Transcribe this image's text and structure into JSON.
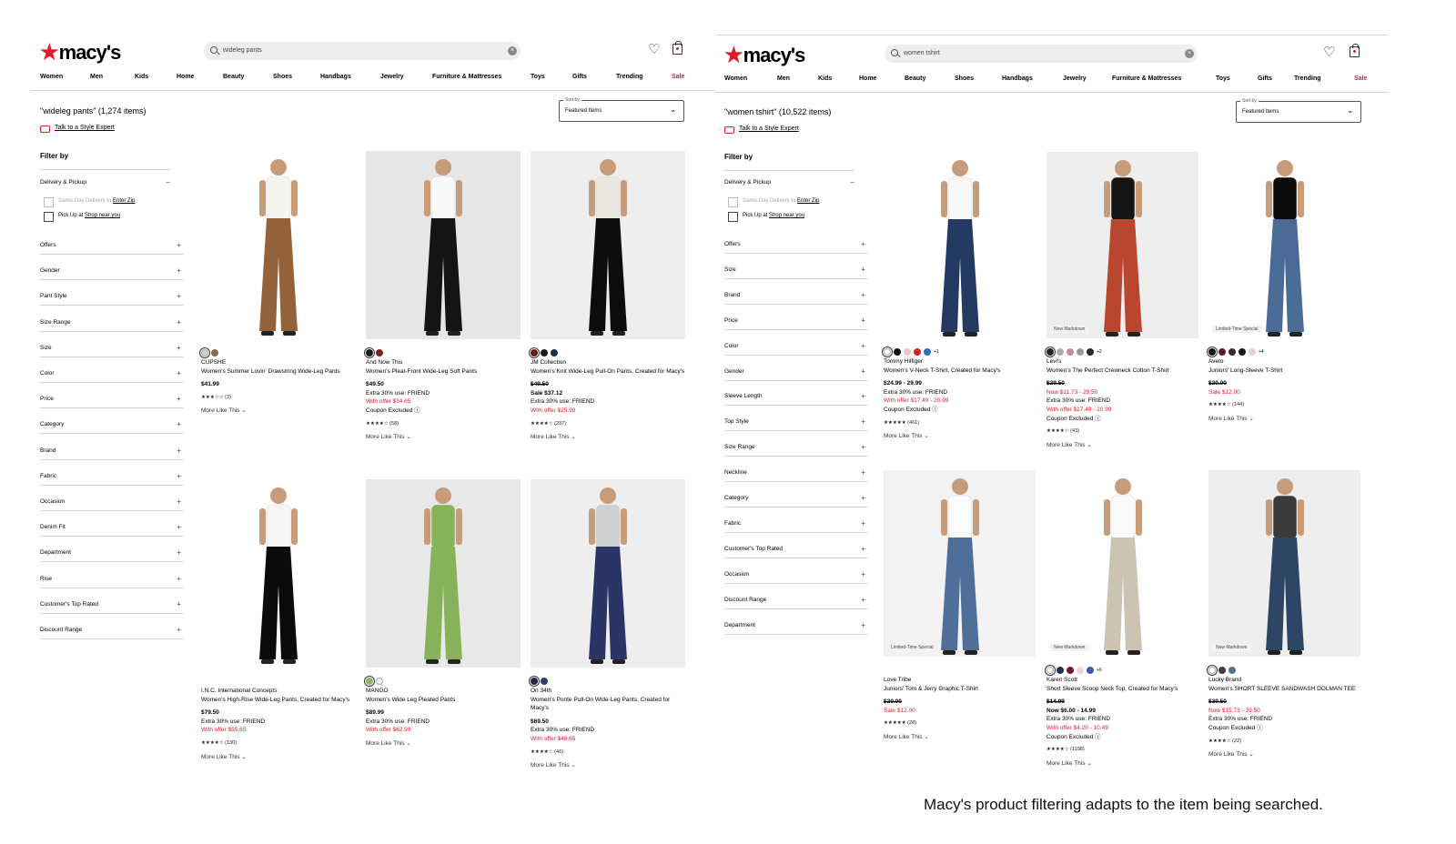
{
  "left": {
    "search_value": "wideleg pants",
    "results": "\"wideleg pants\" (1,274 items)",
    "filters": [
      "Offers",
      "Gender",
      "Pant Style",
      "Size Range",
      "Size",
      "Color",
      "Price",
      "Category",
      "Brand",
      "Fabric",
      "Occasion",
      "Denim Fit",
      "Department",
      "Rise",
      "Customer's Top Rated",
      "Discount Range"
    ],
    "products": [
      {
        "brand": "CUPSHE",
        "name": "Women's Summer Lovin' Drawstring Wide-Leg Pants",
        "lines": [
          {
            "t": "$41.99",
            "c": "price"
          }
        ],
        "rating": "★★★☆☆ (3)",
        "swatches": [
          "#d5cfc4",
          "#8b6a50"
        ],
        "colors": {
          "bg": "#ffffff",
          "top": "#f5f5f0",
          "bottom": "#94623b"
        }
      },
      {
        "brand": "And Now This",
        "name": "Women's Pleat-Front Wide-Leg Soft Pants",
        "lines": [
          {
            "t": "$49.50",
            "c": "price"
          },
          {
            "t": "Extra 30% use: FRIEND",
            "c": "plain"
          },
          {
            "t": "With offer $34.65",
            "c": "red"
          },
          {
            "t": "Coupon Excluded ⓘ",
            "c": "plain"
          }
        ],
        "rating": "★★★★☆ (58)",
        "swatches": [
          "#1a1a1a",
          "#7a2222"
        ],
        "colors": {
          "bg": "#e6e6e6",
          "top": "#f8f8f8",
          "bottom": "#141414"
        }
      },
      {
        "brand": "JM Collection",
        "name": "Women's Knit Wide-Leg Pull-On Pants, Created for Macy's",
        "lines": [
          {
            "t": "$49.50",
            "c": "strike"
          },
          {
            "t": "Sale $37.12",
            "c": "sale"
          },
          {
            "t": "Extra 30% use: FRIEND",
            "c": "plain"
          },
          {
            "t": "With offer $25.98",
            "c": "red"
          }
        ],
        "rating": "★★★★☆ (237)",
        "swatches": [
          "#6b1414",
          "#1c1c1c",
          "#1d2a52"
        ],
        "colors": {
          "bg": "#eeeeee",
          "top": "#e9e6e0",
          "bottom": "#0d0d0d"
        }
      },
      {
        "brand": "I.N.C. International Concepts",
        "name": "Women's High-Rise Wide-Leg Pants, Created for Macy's",
        "lines": [
          {
            "t": "$79.50",
            "c": "price"
          },
          {
            "t": "Extra 30% use: FRIEND",
            "c": "plain"
          },
          {
            "t": "With offer $55.65",
            "c": "red"
          }
        ],
        "rating": "★★★★☆ (130)",
        "swatches": [],
        "colors": {
          "bg": "#ffffff",
          "top": "#f5f5f5",
          "bottom": "#0b0b0b"
        }
      },
      {
        "brand": "MANGO",
        "name": "Women's Wide Leg Pleated Pants",
        "lines": [
          {
            "t": "$89.99",
            "c": "price"
          },
          {
            "t": "Extra 30% use: FRIEND",
            "c": "plain"
          },
          {
            "t": "With offer $62.99",
            "c": "red"
          }
        ],
        "rating": "",
        "swatches": [
          "#8fb566",
          "#f3f1ea"
        ],
        "colors": {
          "bg": "#e8e8e8",
          "top": "#86b35a",
          "bottom": "#86b35a"
        }
      },
      {
        "brand": "On 34th",
        "name": "Women's Ponte Pull-On Wide-Leg Pants, Created for Macy's",
        "lines": [
          {
            "t": "$69.50",
            "c": "price"
          },
          {
            "t": "Extra 30% use: FRIEND",
            "c": "plain"
          },
          {
            "t": "With offer $48.65",
            "c": "red"
          }
        ],
        "rating": "★★★★☆ (46)",
        "swatches": [
          "#1c2744",
          "#2f3c66"
        ],
        "colors": {
          "bg": "#eeeeee",
          "top": "#cfd0d2",
          "bottom": "#2a3566"
        }
      }
    ]
  },
  "right": {
    "search_value": "women tshirt",
    "results": "\"women tshirt\" (10,522 items)",
    "filters": [
      "Offers",
      "Size",
      "Brand",
      "Price",
      "Color",
      "Gender",
      "Sleeve Length",
      "Top Style",
      "Size Range",
      "Neckline",
      "Category",
      "Fabric",
      "Customer's Top Rated",
      "Occasion",
      "Discount Range",
      "Department"
    ],
    "products": [
      {
        "brand": "Tommy Hilfiger",
        "name": "Women's V-Neck T-Shirt, Created for Macy's",
        "lines": [
          {
            "t": "$24.99 - 29.99",
            "c": "price"
          },
          {
            "t": "Extra 30% use: FRIEND",
            "c": "plain"
          },
          {
            "t": "With offer $17.49 - 20.99",
            "c": "red"
          },
          {
            "t": "Coupon Excluded ⓘ",
            "c": "plain"
          }
        ],
        "rating": "★★★★★ (461)",
        "swatches": [
          "#ffffff",
          "#111111",
          "#e8c6cf",
          "#d8232a",
          "#2f6fb7"
        ],
        "more": "+1",
        "badge": "",
        "colors": {
          "bg": "#ffffff",
          "top": "#f8f8f8",
          "bottom": "#253a63"
        }
      },
      {
        "brand": "Levi's",
        "name": "Women's The Perfect Crewneck Cotton T-Shirt",
        "lines": [
          {
            "t": "$29.50",
            "c": "strike"
          },
          {
            "t": "Now $11.73 - 29.50",
            "c": "red"
          },
          {
            "t": "Extra 30% use: FRIEND",
            "c": "plain"
          },
          {
            "t": "With offer $17.49 - 20.99",
            "c": "red"
          },
          {
            "t": "Coupon Excluded ⓘ",
            "c": "plain"
          }
        ],
        "rating": "★★★★☆ (43)",
        "swatches": [
          "#222222",
          "#b5a8b8",
          "#c28aa6",
          "#9a9a9a",
          "#2a2a2a"
        ],
        "more": "+2",
        "badge": "New Markdown",
        "colors": {
          "bg": "#eeeeee",
          "top": "#151515",
          "bottom": "#b9472f"
        }
      },
      {
        "brand": "Aveto",
        "name": "Juniors' Long-Sleeve T-Shirt",
        "lines": [
          {
            "t": "$20.00",
            "c": "strike"
          },
          {
            "t": "Sale $12.00",
            "c": "red"
          }
        ],
        "rating": "★★★★☆ (144)",
        "swatches": [
          "#111111",
          "#5a1e1e",
          "#3a2a2a",
          "#1a1a2e",
          "#e9cfcf"
        ],
        "more": "+4",
        "badge": "Limited-Time Special",
        "colors": {
          "bg": "#ffffff",
          "top": "#0a0a0a",
          "bottom": "#4a6b95"
        }
      },
      {
        "brand": "Love Tribe",
        "name": "Juniors' Tom & Jerry Graphic T-Shirt",
        "lines": [
          {
            "t": "$20.00",
            "c": "strike"
          },
          {
            "t": "Sale $12.00",
            "c": "red"
          }
        ],
        "rating": "★★★★★ (28)",
        "swatches": [],
        "more": "",
        "badge": "Limited-Time Special",
        "colors": {
          "bg": "#f2f2f2",
          "top": "#fbfbfb",
          "bottom": "#4d6f9a"
        }
      },
      {
        "brand": "Karen Scott",
        "name": "Short Sleeve Scoop Neck Top, Created for Macy's",
        "lines": [
          {
            "t": "$14.99",
            "c": "strike"
          },
          {
            "t": "Now $6.00 - 14.99",
            "c": "sale"
          },
          {
            "t": "Extra 30% use: FRIEND",
            "c": "plain"
          },
          {
            "t": "With offer $4.20 - 10.49",
            "c": "red"
          },
          {
            "t": "Coupon Excluded ⓘ",
            "c": "plain"
          }
        ],
        "rating": "★★★★☆ (1198)",
        "swatches": [
          "#ffffff",
          "#1f2f55",
          "#6b1d2e",
          "#e9d4e0",
          "#3a5da6"
        ],
        "more": "+6",
        "badge": "New Markdown",
        "colors": {
          "bg": "#ffffff",
          "top": "#fafafa",
          "bottom": "#ccc3b3"
        }
      },
      {
        "brand": "Lucky Brand",
        "name": "Women's SHORT SLEEVE SANDWASH DOLMAN TEE",
        "lines": [
          {
            "t": "$39.50",
            "c": "strike"
          },
          {
            "t": "Now $15.73 - 39.50",
            "c": "red"
          },
          {
            "t": "Extra 30% use: FRIEND",
            "c": "plain"
          },
          {
            "t": "Coupon Excluded ⓘ",
            "c": "plain"
          }
        ],
        "rating": "★★★★☆ (22)",
        "swatches": [
          "#ffffff",
          "#3e3e3e",
          "#5a6f8c"
        ],
        "more": "",
        "badge": "New Markdown",
        "colors": {
          "bg": "#eeeeee",
          "top": "#3b3b3b",
          "bottom": "#2e4566"
        }
      }
    ]
  },
  "common": {
    "logo": "macy's",
    "nav": [
      "Women",
      "Men",
      "Kids",
      "Home",
      "Beauty",
      "Shoes",
      "Handbags",
      "Jewelry",
      "Furniture & Mattresses",
      "Toys",
      "Gifts",
      "Trending",
      "Sale"
    ],
    "talk_to_stylist": "Talk to a Style Expert",
    "sort_label": "Sort by",
    "sort_value": "Featured Items",
    "filter_by": "Filter by",
    "delivery": "Delivery & Pickup",
    "sameday": "Same-Day Delivery",
    "sameday_to": "to",
    "enter_zip": "Enter Zip",
    "pickup": "Pick Up",
    "pickup_at": "at",
    "shop_near": "Shop near you",
    "more_like": "More Like This"
  },
  "caption": "Macy's product filtering adapts to the item being searched.",
  "colors": {
    "brand_red": "#e11a2b"
  }
}
